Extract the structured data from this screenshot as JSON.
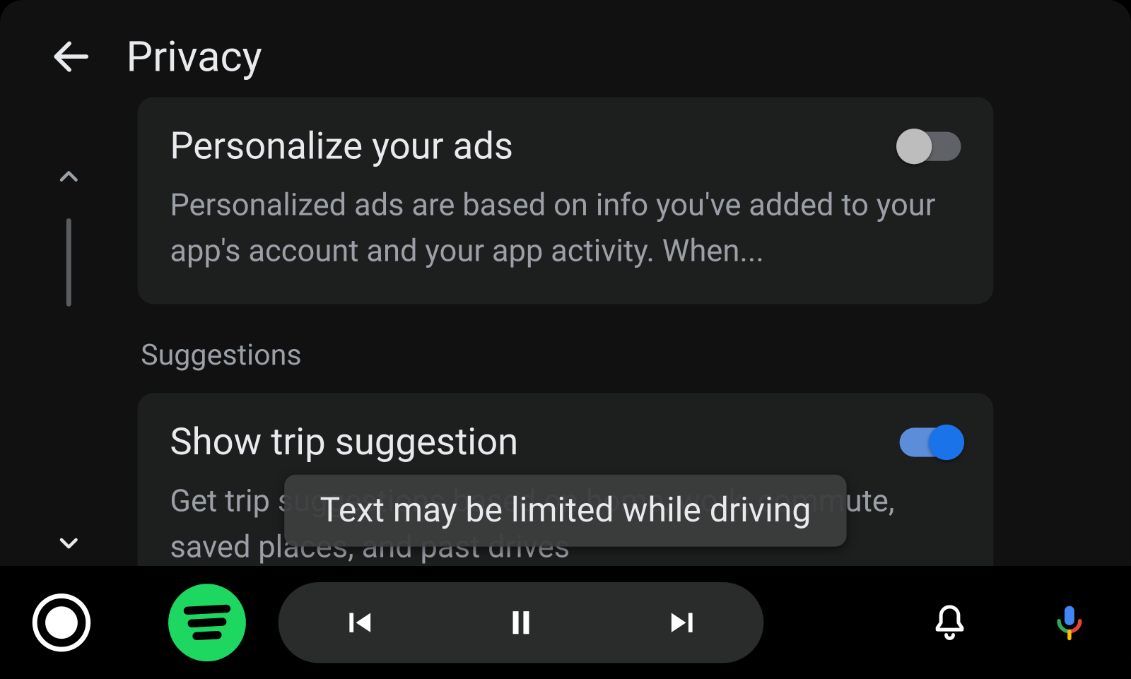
{
  "header": {
    "title": "Privacy"
  },
  "settings": {
    "personalize_ads": {
      "title": "Personalize your ads",
      "description": "Personalized ads are based on info you've added to your app's account and your app activity. When...",
      "enabled": false
    },
    "trip_suggestion": {
      "title": "Show trip suggestion",
      "description": "Get trip suggestions based on home, work, commute, saved places, and past drives",
      "enabled": true
    }
  },
  "sections": {
    "suggestions_label": "Suggestions"
  },
  "toast": {
    "message": "Text may be limited while driving"
  },
  "colors": {
    "spotify_green": "#1ed760",
    "toggle_on": "#1a73e8"
  }
}
